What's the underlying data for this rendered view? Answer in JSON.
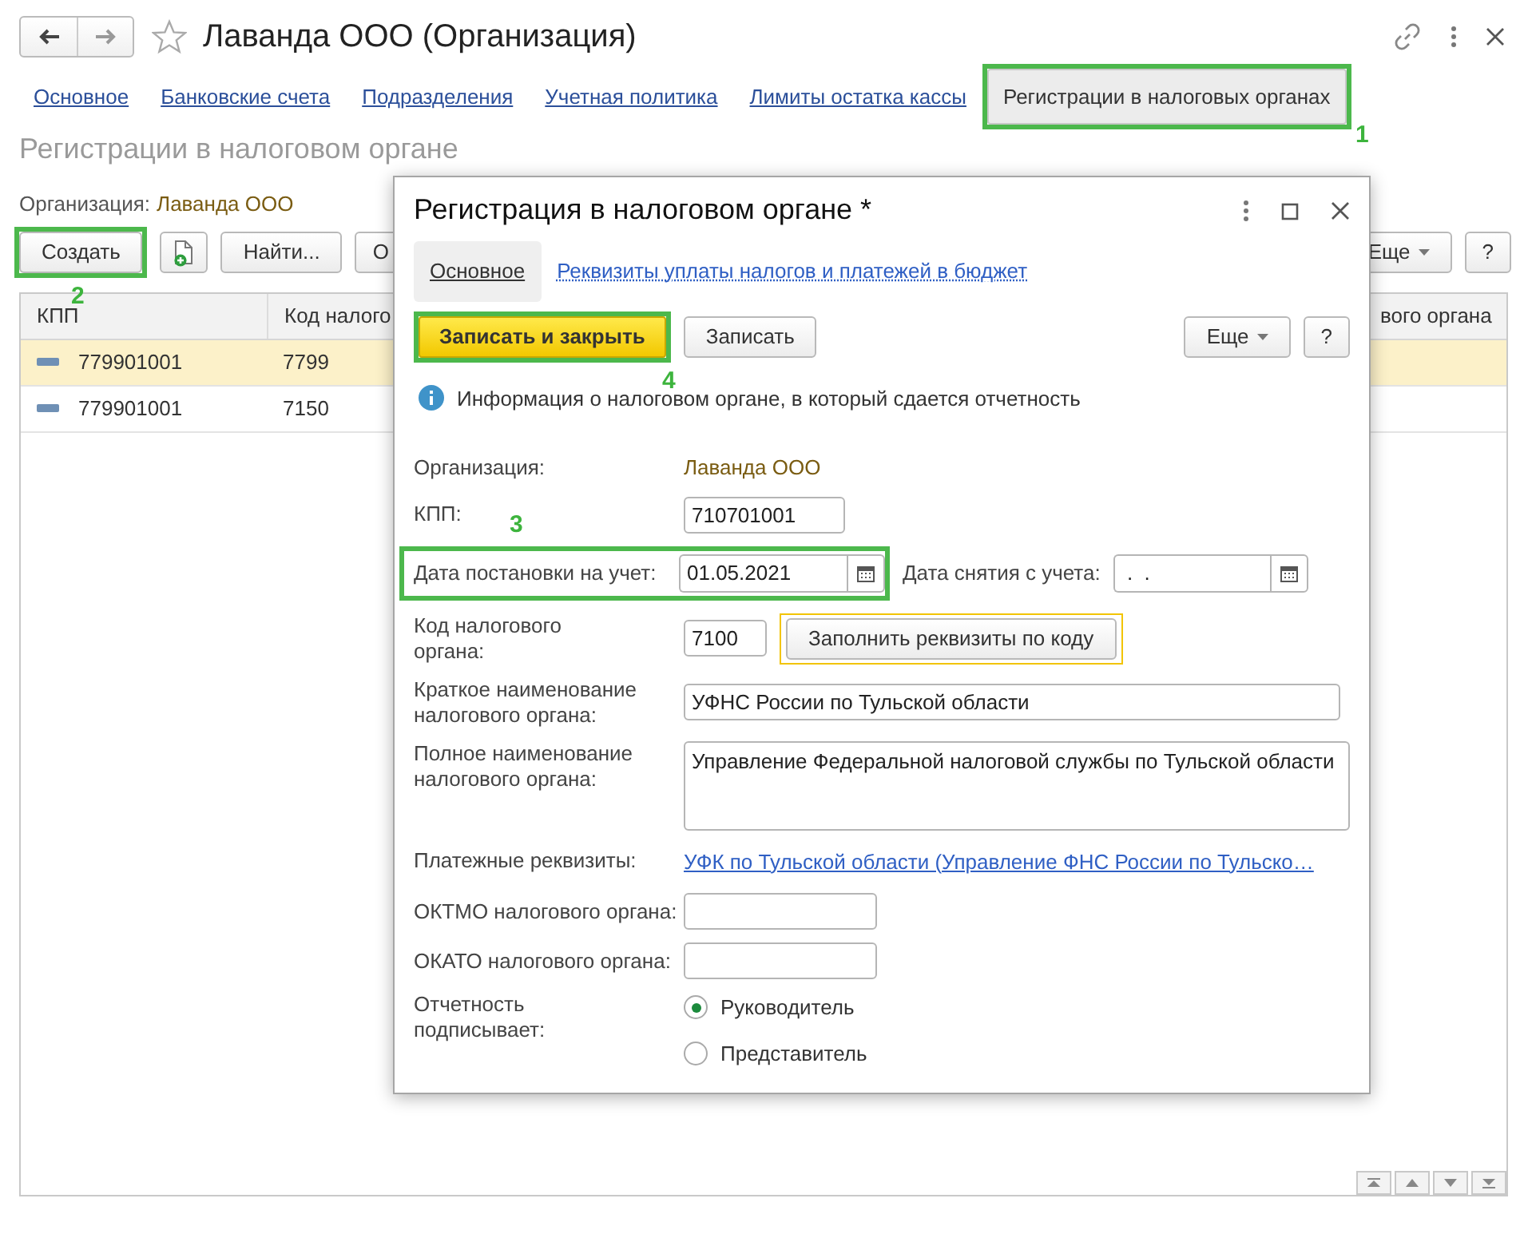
{
  "window": {
    "title": "Лаванда ООО (Организация)"
  },
  "tabs": [
    {
      "label": "Основное",
      "selected": false
    },
    {
      "label": "Банковские счета",
      "selected": false
    },
    {
      "label": "Подразделения",
      "selected": false
    },
    {
      "label": "Учетная политика",
      "selected": false
    },
    {
      "label": "Лимиты остатка кассы",
      "selected": false
    },
    {
      "label": "Регистрации в налоговых органах",
      "selected": true,
      "callout": "1"
    }
  ],
  "section_title": "Регистрации в налоговом органе",
  "organization": {
    "label": "Организация:",
    "value": "Лаванда ООО"
  },
  "toolbar": {
    "buttons": [
      {
        "kind": "text",
        "label": "Создать",
        "callout": "2"
      },
      {
        "kind": "icon"
      },
      {
        "kind": "text",
        "label": "Найти..."
      },
      {
        "kind": "text",
        "label": "О"
      }
    ],
    "right_buttons": [
      {
        "kind": "menu",
        "label": "Еще"
      },
      {
        "kind": "text",
        "label": "?"
      }
    ]
  },
  "table": {
    "columns": [
      "КПП",
      "Код налого",
      "вого органа"
    ],
    "rows": [
      {
        "cells": [
          "779901001",
          "7799"
        ],
        "selected": true
      },
      {
        "cells": [
          "779901001",
          "7150"
        ],
        "selected": false
      }
    ]
  },
  "dialog": {
    "title": "Регистрация в налоговом органе *",
    "tabs": [
      {
        "label": "Основное",
        "selected": true
      },
      {
        "label": "Реквизиты уплаты налогов и платежей в бюджет",
        "selected": false
      }
    ],
    "buttons": [
      {
        "kind": "primary",
        "label": "Записать и закрыть",
        "callout": "4"
      },
      {
        "kind": "default",
        "label": "Записать"
      }
    ],
    "right_buttons": [
      {
        "kind": "menu",
        "label": "Еще"
      },
      {
        "kind": "default",
        "label": "?"
      }
    ],
    "info": "Информация о налоговом органе, в который сдается отчетность",
    "fields": [
      {
        "kind": "static",
        "label": "Организация:",
        "value": "Лаванда ООО"
      },
      {
        "kind": "input",
        "label": "КПП:",
        "value": "710701001"
      },
      {
        "kind": "date_pair",
        "label": "Дата постановки на учет:",
        "value": "01.05.2021",
        "callout": "3",
        "second_label": "Дата снятия с учета:",
        "second_value": " .  ."
      },
      {
        "kind": "code",
        "label": "Код налогового\nоргана:",
        "value": "7100",
        "button": "Заполнить реквизиты по коду",
        "button_focused": true
      },
      {
        "kind": "wide",
        "label": "Краткое наименование\nналогового органа:",
        "value": "УФНС России по Тульской области"
      },
      {
        "kind": "textarea",
        "label": "Полное наименование\nналогового органа:",
        "value": "Управление Федеральной налоговой службы по Тульской области"
      },
      {
        "kind": "link",
        "label": "Платежные реквизиты:",
        "value": "УФК по Тульской области (Управление ФНС России по Тульско…"
      },
      {
        "kind": "input",
        "label": "ОКТМО налогового органа:"
      },
      {
        "kind": "input",
        "label": "ОКАТО налогового органа:"
      },
      {
        "kind": "radio",
        "label": "Отчетность\nподписывает:",
        "options": [
          {
            "label": "Руководитель",
            "selected": true
          },
          {
            "label": "Представитель",
            "selected": false
          }
        ]
      }
    ]
  }
}
